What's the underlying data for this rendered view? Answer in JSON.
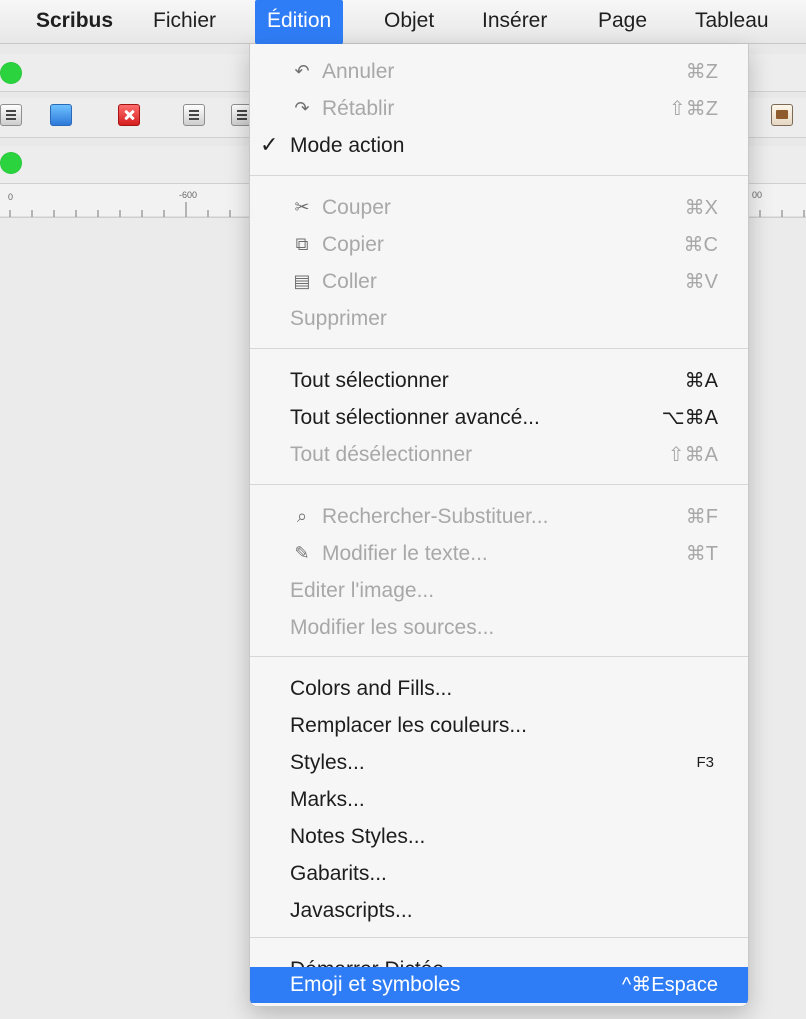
{
  "menubar": {
    "items": [
      "Scribus",
      "Fichier",
      "Édition",
      "Objet",
      "Insérer",
      "Page",
      "Tableau"
    ]
  },
  "menu": {
    "sections": [
      [
        {
          "label": "Annuler",
          "shortcut": "⌘Z",
          "enabled": false,
          "icon": "undo-icon"
        },
        {
          "label": "Rétablir",
          "shortcut": "⇧⌘Z",
          "enabled": false,
          "icon": "redo-icon"
        },
        {
          "label": "Mode action",
          "shortcut": "",
          "enabled": true,
          "checked": true
        }
      ],
      [
        {
          "label": "Couper",
          "shortcut": "⌘X",
          "enabled": false,
          "icon": "scissors-icon"
        },
        {
          "label": "Copier",
          "shortcut": "⌘C",
          "enabled": false,
          "icon": "copy-icon"
        },
        {
          "label": "Coller",
          "shortcut": "⌘V",
          "enabled": false,
          "icon": "paste-icon"
        },
        {
          "label": "Supprimer",
          "shortcut": "",
          "enabled": false
        }
      ],
      [
        {
          "label": "Tout sélectionner",
          "shortcut": "⌘A",
          "enabled": true
        },
        {
          "label": "Tout sélectionner avancé...",
          "shortcut": "⌥⌘A",
          "enabled": true
        },
        {
          "label": "Tout désélectionner",
          "shortcut": "⇧⌘A",
          "enabled": false
        }
      ],
      [
        {
          "label": "Rechercher-Substituer...",
          "shortcut": "⌘F",
          "enabled": false,
          "icon": "search-replace-icon"
        },
        {
          "label": "Modifier le texte...",
          "shortcut": "⌘T",
          "enabled": false,
          "icon": "edit-text-icon"
        },
        {
          "label": "Editer l'image...",
          "shortcut": "",
          "enabled": false
        },
        {
          "label": "Modifier les sources...",
          "shortcut": "",
          "enabled": false
        }
      ],
      [
        {
          "label": "Colors and Fills...",
          "shortcut": "",
          "enabled": true
        },
        {
          "label": "Remplacer les couleurs...",
          "shortcut": "",
          "enabled": true
        },
        {
          "label": "Styles...",
          "shortcut": "F3",
          "enabled": true
        },
        {
          "label": "Marks...",
          "shortcut": "",
          "enabled": true
        },
        {
          "label": "Notes Styles...",
          "shortcut": "",
          "enabled": true
        },
        {
          "label": "Gabarits...",
          "shortcut": "",
          "enabled": true
        },
        {
          "label": "Javascripts...",
          "shortcut": "",
          "enabled": true
        }
      ],
      [
        {
          "label": "Démarrer Dictée...",
          "shortcut": "",
          "enabled": true
        },
        {
          "label": "Emoji et symboles",
          "shortcut": "^⌘Espace",
          "enabled": true,
          "highlighted": true
        }
      ]
    ]
  },
  "ruler": {
    "labels": [
      "0",
      "-600",
      "00"
    ]
  },
  "colors": {
    "accent": "#2f7df6",
    "disabled_text": "#a8a8a8",
    "status_green": "#2bd33e"
  }
}
